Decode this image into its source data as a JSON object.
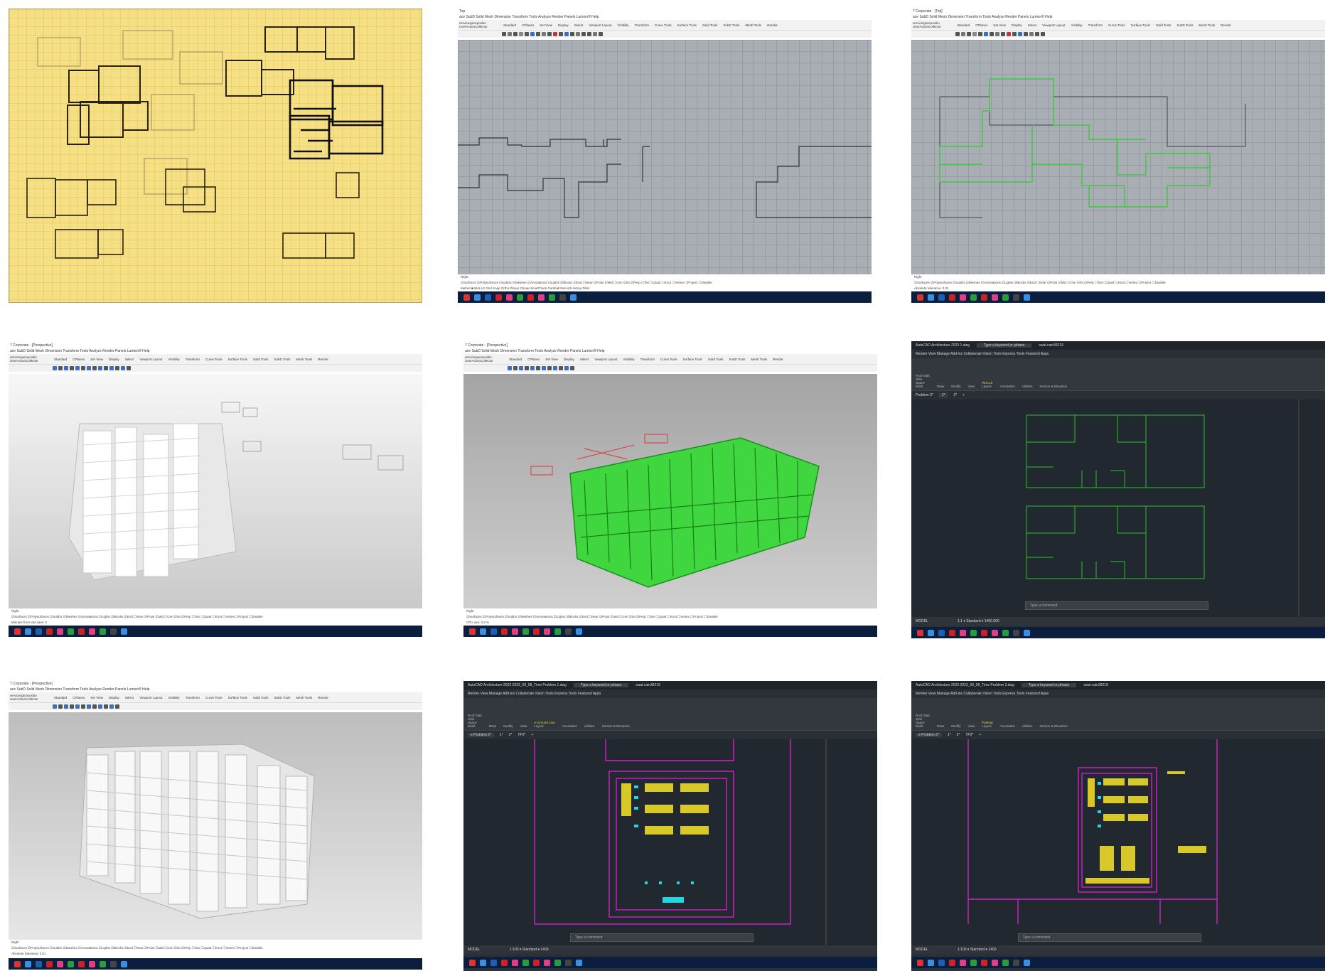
{
  "rhino": {
    "menu": "ace  SubD  Solid  Mesh  Dimension  Transform  Tools  Analyze  Render  Panels  Lumion®  Help",
    "command_history": "servicesjacepositio\nUserActionCollector",
    "tabs": [
      "Standard",
      "CPlanes",
      "Set View",
      "Display",
      "Select",
      "Viewport Layout",
      "Visibility",
      "Transform",
      "Curve Tools",
      "Surface Tools",
      "Solid Tools",
      "SubD Tools",
      "Mesh Tools",
      "Render"
    ],
    "viewport_tab": "Right",
    "osnap_filters": "☑Surfaces  ☑Polysurfaces ☑SubDs ☑Meshes ☑Annotations ☑Lights ☑Blocks  ☑End ☐Near ☑Point ☑Mid ☐Cen ☑Int ☑Perp ☐Tan ☐Quad ☐Knot ☐Vertex ☐Project ☐Disable",
    "status_bar": "Metres   ■ WALLS      Grid Snap  Ortho  Planar  Osnap  SmartTrack  Gumball  Record History  Filter",
    "top_title": "Top",
    "corporate_top_title": "7 Corporate - [Top]",
    "corporate_persp_title": "7 Corporate - [Perspective]",
    "status_minutes": "Minutes from last save: 237",
    "status_tolerance": "Absolute tolerance: 0.01",
    "status_cpu": "CPU use: 2.9 %",
    "status_minutes0": "Minutes from last save: 0"
  },
  "autocad": {
    "app_title_1": "AutoCAD Architecture 2023   1.dwg",
    "app_title_2": "AutoCAD Architecture 2023   2023_09_08_Time Problem 1.dwg",
    "app_title_3": "AutoCAD Architecture 2023   2023_09_08_Time Problem 3.dwg",
    "search_placeholder": "Type a keyword or phrase",
    "user": "swal.cain39219",
    "ribbon_tabs": "Render  View  Manage  Add-ins  Collaborate  Vision Tools  Express Tools  Featured Apps",
    "ribbon_groups": [
      "Build",
      "Draw",
      "Modify",
      "View",
      "Layers",
      "Annotation",
      "Utilities",
      "Section & Elevation"
    ],
    "build_items": [
      "Roof Slab",
      "Stair",
      "Space"
    ],
    "doc_tabs_1": [
      "Problem 3*",
      "1*",
      "2*"
    ],
    "doc_tabs_2": [
      "e Problem 3*",
      "1*",
      "2*",
      "TP2*"
    ],
    "command_placeholder": "Type a command",
    "layer_1": "WALLS",
    "layer_2": "A-Ground Line",
    "layer_3": "Parking",
    "status_1": "MODEL",
    "status_2": "1:1 ▾  Standard ▾  1400.000",
    "status_3": "1:100 ▾  Standard ▾  1400"
  }
}
